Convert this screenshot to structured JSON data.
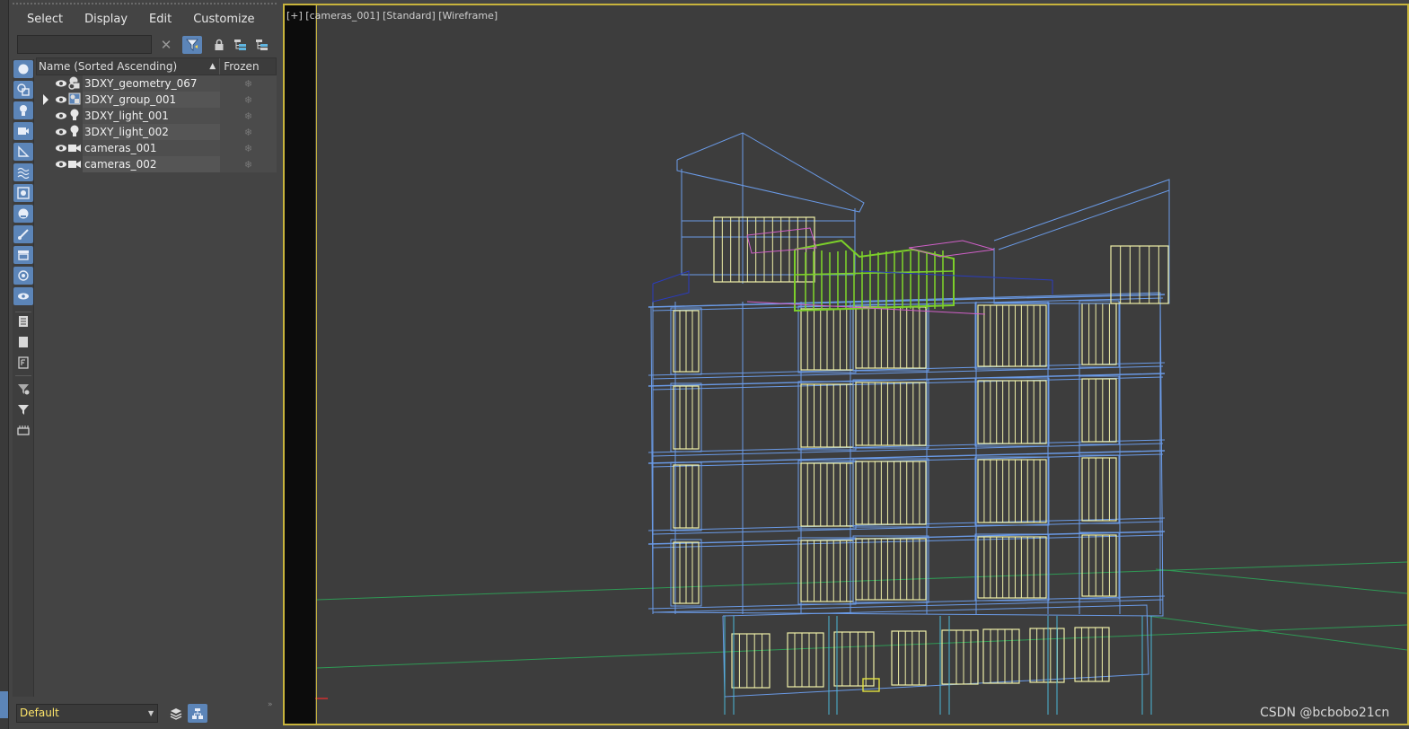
{
  "menu": [
    "Select",
    "Display",
    "Edit",
    "Customize"
  ],
  "search": {
    "value": "",
    "placeholder": ""
  },
  "list": {
    "header_name": "Name (Sorted Ascending)",
    "header_sort": "▲",
    "header_frozen": "Frozen",
    "rows": [
      {
        "name": "3DXY_geometry_067",
        "icon": "geometry-icon",
        "expander": false
      },
      {
        "name": "3DXY_group_001",
        "icon": "group-icon",
        "expander": true
      },
      {
        "name": "3DXY_light_001",
        "icon": "light-icon",
        "expander": false
      },
      {
        "name": "3DXY_light_002",
        "icon": "light-icon",
        "expander": false
      },
      {
        "name": "cameras_001",
        "icon": "camera-icon",
        "expander": false
      },
      {
        "name": "cameras_002",
        "icon": "camera-icon",
        "expander": false
      }
    ]
  },
  "layer": {
    "current": "Default"
  },
  "viewport": {
    "label": "[+] [cameras_001] [Standard] [Wireframe]",
    "frame_color": "#c8b43c"
  },
  "watermark": "CSDN @bcbobo21cn",
  "colors": {
    "accent": "#5c85b8",
    "wire_blue": "#6a9ae6",
    "wire_yellow": "#f0f0a8",
    "wire_green": "#7ccf2a",
    "wire_pink": "#d060c8",
    "grid_green": "#2f9a55"
  }
}
